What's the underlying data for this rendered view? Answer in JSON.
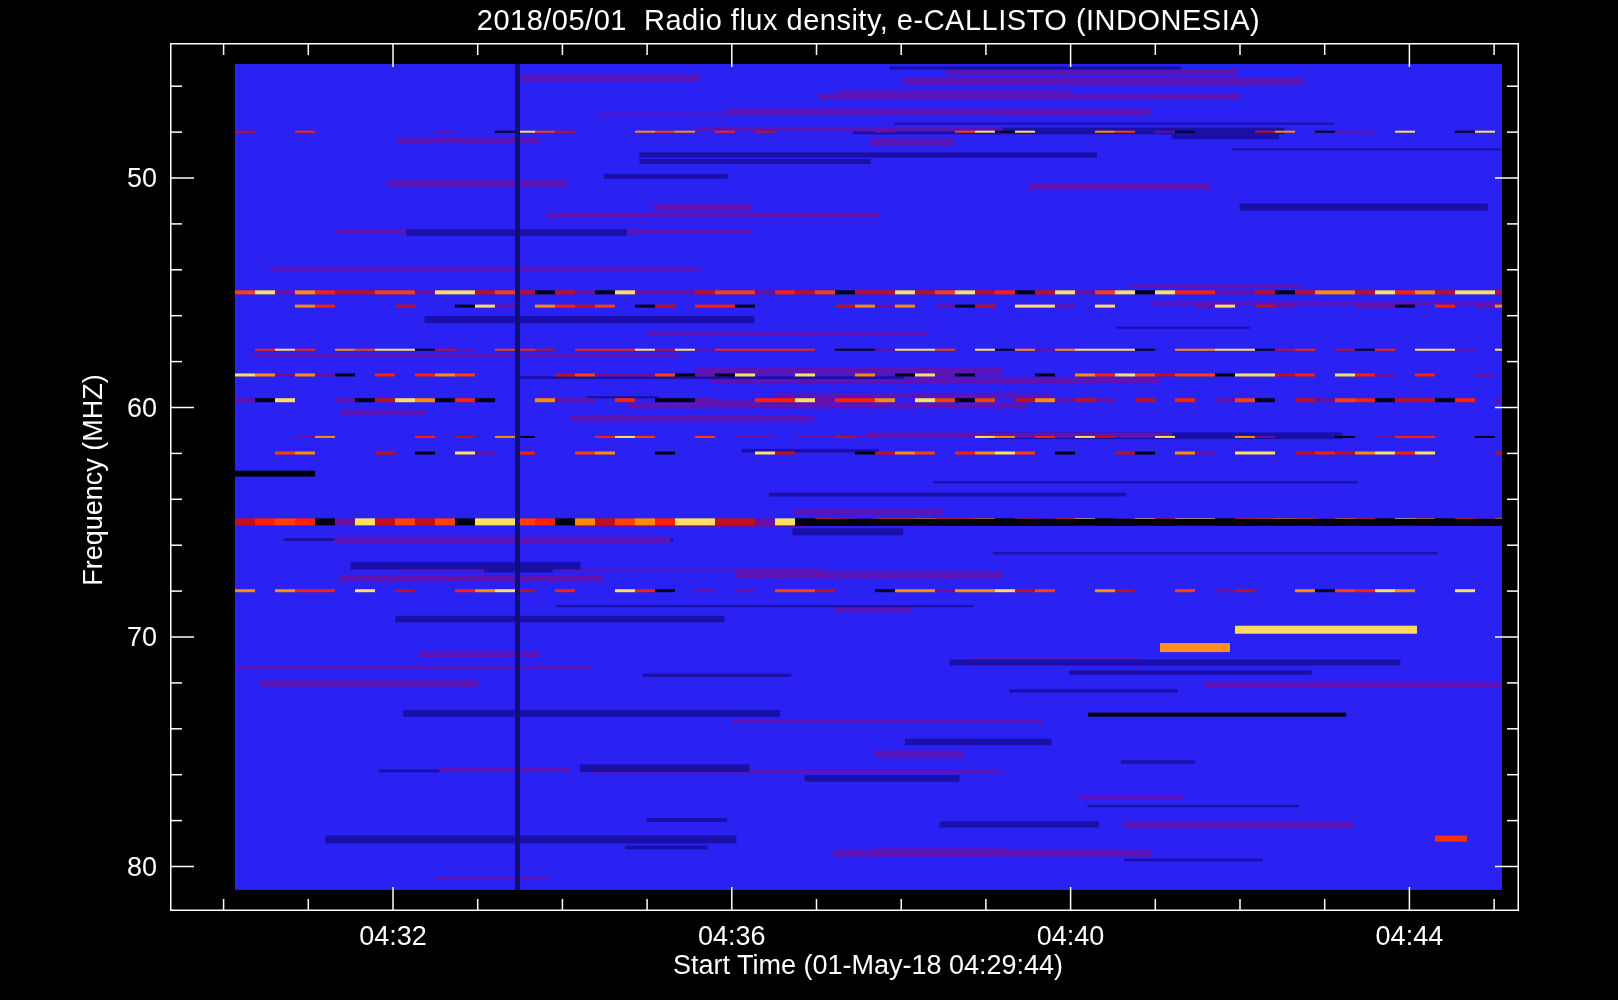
{
  "title": "2018/05/01  Radio flux density, e-CALLISTO (INDONESIA)",
  "y_axis": {
    "label": "Frequency (MHZ)",
    "ticks": [
      "50",
      "60",
      "70",
      "80"
    ]
  },
  "x_axis": {
    "label": "Start Time (01-May-18 04:29:44)",
    "ticks": [
      "04:32",
      "04:36",
      "04:40",
      "04:44"
    ]
  }
}
